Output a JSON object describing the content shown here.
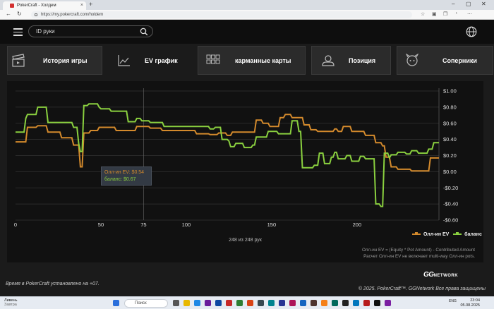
{
  "browser": {
    "tab_title": "PokerCraft - Холдем",
    "url": "https://my.pokercraft.com/holdem",
    "new_tab": "+",
    "close_tab": "×"
  },
  "header": {
    "search_placeholder": "ID руки"
  },
  "nav": {
    "tabs": [
      {
        "label": "История игры",
        "icon": "clapperboard-icon",
        "active": false
      },
      {
        "label": "EV график",
        "icon": "line-chart-icon",
        "active": true
      },
      {
        "label": "карманные карты",
        "icon": "grid-icon",
        "active": false
      },
      {
        "label": "Позиция",
        "icon": "position-icon",
        "active": false
      },
      {
        "label": "Соперники",
        "icon": "opponent-icon",
        "active": false
      }
    ]
  },
  "tooltip": {
    "ev_label": "Олл-ин EV: $0.54",
    "balance_label": "баланс: $0.67"
  },
  "chart_data": {
    "type": "line",
    "xlabel": "",
    "ylabel": "",
    "xlim": [
      0,
      248
    ],
    "ylim": [
      -0.6,
      1.0
    ],
    "x_ticks": [
      "0",
      "50",
      "75",
      "100",
      "150",
      "200"
    ],
    "y_ticks": [
      "$1.00",
      "$0.80",
      "$0.60",
      "$0.40",
      "$0.20",
      "$0.00",
      "-$0.20",
      "-$0.40",
      "-$0.60"
    ],
    "grid": true,
    "legend_position": "bottom-right",
    "series": [
      {
        "name": "Олл-ин EV",
        "color": "#d48a2c",
        "points": [
          [
            0,
            0.37
          ],
          [
            6,
            0.37
          ],
          [
            7,
            0.55
          ],
          [
            12,
            0.55
          ],
          [
            13,
            0.57
          ],
          [
            18,
            0.57
          ],
          [
            19,
            0.49
          ],
          [
            26,
            0.49
          ],
          [
            27,
            0.42
          ],
          [
            33,
            0.42
          ],
          [
            34,
            0.33
          ],
          [
            37,
            0.33
          ],
          [
            38,
            0.06
          ],
          [
            39,
            0.06
          ],
          [
            40,
            0.48
          ],
          [
            43,
            0.48
          ],
          [
            44,
            0.51
          ],
          [
            48,
            0.51
          ],
          [
            49,
            0.55
          ],
          [
            58,
            0.55
          ],
          [
            59,
            0.51
          ],
          [
            70,
            0.51
          ],
          [
            71,
            0.56
          ],
          [
            78,
            0.56
          ],
          [
            79,
            0.54
          ],
          [
            85,
            0.54
          ],
          [
            86,
            0.51
          ],
          [
            105,
            0.51
          ],
          [
            106,
            0.47
          ],
          [
            113,
            0.47
          ],
          [
            114,
            0.46
          ],
          [
            118,
            0.46
          ],
          [
            119,
            0.48
          ],
          [
            123,
            0.48
          ],
          [
            124,
            0.45
          ],
          [
            126,
            0.45
          ],
          [
            127,
            0.49
          ],
          [
            140,
            0.49
          ],
          [
            141,
            0.64
          ],
          [
            144,
            0.64
          ],
          [
            145,
            0.6
          ],
          [
            148,
            0.6
          ],
          [
            149,
            0.56
          ],
          [
            154,
            0.56
          ],
          [
            155,
            0.67
          ],
          [
            157,
            0.67
          ],
          [
            158,
            0.71
          ],
          [
            161,
            0.71
          ],
          [
            162,
            0.67
          ],
          [
            168,
            0.67
          ],
          [
            169,
            0.58
          ],
          [
            172,
            0.58
          ],
          [
            173,
            0.52
          ],
          [
            176,
            0.52
          ],
          [
            177,
            0.5
          ],
          [
            186,
            0.5
          ],
          [
            187,
            0.53
          ],
          [
            188,
            0.53
          ],
          [
            189,
            0.5
          ],
          [
            191,
            0.5
          ],
          [
            192,
            0.56
          ],
          [
            196,
            0.56
          ],
          [
            197,
            0.5
          ],
          [
            204,
            0.5
          ],
          [
            205,
            0.45
          ],
          [
            210,
            0.45
          ],
          [
            211,
            0.36
          ],
          [
            214,
            0.36
          ],
          [
            215,
            0.32
          ],
          [
            216,
            0.32
          ],
          [
            217,
            0.18
          ],
          [
            219,
            0.18
          ],
          [
            220,
            0.06
          ],
          [
            223,
            0.06
          ],
          [
            224,
            0.03
          ],
          [
            231,
            0.03
          ],
          [
            232,
            0.01
          ],
          [
            242,
            0.01
          ],
          [
            243,
            0.17
          ],
          [
            248,
            0.17
          ]
        ]
      },
      {
        "name": "баланс",
        "color": "#8ad03f",
        "points": [
          [
            0,
            0.49
          ],
          [
            5,
            0.49
          ],
          [
            6,
            0.66
          ],
          [
            7,
            0.71
          ],
          [
            12,
            0.71
          ],
          [
            13,
            0.8
          ],
          [
            18,
            0.8
          ],
          [
            19,
            0.61
          ],
          [
            33,
            0.61
          ],
          [
            34,
            0.55
          ],
          [
            36,
            0.55
          ],
          [
            37,
            0.35
          ],
          [
            38,
            0.25
          ],
          [
            39,
            0.25
          ],
          [
            40,
            0.82
          ],
          [
            42,
            0.82
          ],
          [
            43,
            0.84
          ],
          [
            48,
            0.84
          ],
          [
            49,
            0.8
          ],
          [
            50,
            0.78
          ],
          [
            55,
            0.78
          ],
          [
            56,
            0.75
          ],
          [
            65,
            0.75
          ],
          [
            66,
            0.62
          ],
          [
            70,
            0.62
          ],
          [
            71,
            0.66
          ],
          [
            73,
            0.66
          ],
          [
            74,
            0.63
          ],
          [
            78,
            0.63
          ],
          [
            79,
            0.61
          ],
          [
            86,
            0.61
          ],
          [
            87,
            0.56
          ],
          [
            113,
            0.56
          ],
          [
            114,
            0.53
          ],
          [
            116,
            0.53
          ],
          [
            117,
            0.55
          ],
          [
            120,
            0.55
          ],
          [
            121,
            0.4
          ],
          [
            124,
            0.4
          ],
          [
            125,
            0.38
          ],
          [
            126,
            0.31
          ],
          [
            128,
            0.31
          ],
          [
            129,
            0.35
          ],
          [
            133,
            0.35
          ],
          [
            134,
            0.3
          ],
          [
            138,
            0.3
          ],
          [
            139,
            0.33
          ],
          [
            140,
            0.33
          ],
          [
            141,
            0.43
          ],
          [
            147,
            0.43
          ],
          [
            148,
            0.5
          ],
          [
            153,
            0.5
          ],
          [
            154,
            0.47
          ],
          [
            161,
            0.47
          ],
          [
            162,
            0.63
          ],
          [
            165,
            0.63
          ],
          [
            166,
            0.5
          ],
          [
            167,
            0.5
          ],
          [
            168,
            0.05
          ],
          [
            174,
            0.05
          ],
          [
            175,
            0.08
          ],
          [
            177,
            0.08
          ],
          [
            178,
            0.23
          ],
          [
            180,
            0.23
          ],
          [
            181,
            0.1
          ],
          [
            184,
            0.1
          ],
          [
            185,
            0.18
          ],
          [
            186,
            0.18
          ],
          [
            187,
            0.24
          ],
          [
            188,
            0.24
          ],
          [
            189,
            0.16
          ],
          [
            193,
            0.16
          ],
          [
            194,
            0.2
          ],
          [
            196,
            0.2
          ],
          [
            197,
            0.13
          ],
          [
            201,
            0.13
          ],
          [
            202,
            0.19
          ],
          [
            204,
            0.19
          ],
          [
            205,
            0.16
          ],
          [
            210,
            0.16
          ],
          [
            211,
            -0.4
          ],
          [
            213,
            -0.4
          ],
          [
            214,
            -0.43
          ],
          [
            215,
            -0.43
          ],
          [
            216,
            0.23
          ],
          [
            218,
            0.23
          ],
          [
            219,
            0.17
          ],
          [
            220,
            0.21
          ],
          [
            223,
            0.21
          ],
          [
            224,
            0.24
          ],
          [
            228,
            0.24
          ],
          [
            229,
            0.22
          ],
          [
            231,
            0.22
          ],
          [
            232,
            0.26
          ],
          [
            235,
            0.26
          ],
          [
            236,
            0.23
          ],
          [
            241,
            0.23
          ],
          [
            242,
            0.28
          ],
          [
            244,
            0.28
          ],
          [
            245,
            0.36
          ],
          [
            248,
            0.36
          ]
        ]
      }
    ],
    "hover_x": 75
  },
  "chart_info": {
    "hands_count": "248 из 248 рук",
    "note_line1": "Олл-ин EV = (Equity * Pot Amount) - Contributed Amount",
    "note_line2": "Расчет Олл-ин EV не включает multi-way Олл-ин pots."
  },
  "footer": {
    "timezone": "Время в PokerCraft установлено на +07.",
    "copyright": "© 2025. PokerCraft™. GGNetwork Все права защищены",
    "logo": "GG",
    "logo_sub": "NETWORK"
  },
  "taskbar": {
    "weather_line1": "Ливень",
    "weather_line2": "Завтра",
    "search": "Поиск",
    "lang": "ENG",
    "time": "23:04",
    "date": "05.08.2025"
  }
}
